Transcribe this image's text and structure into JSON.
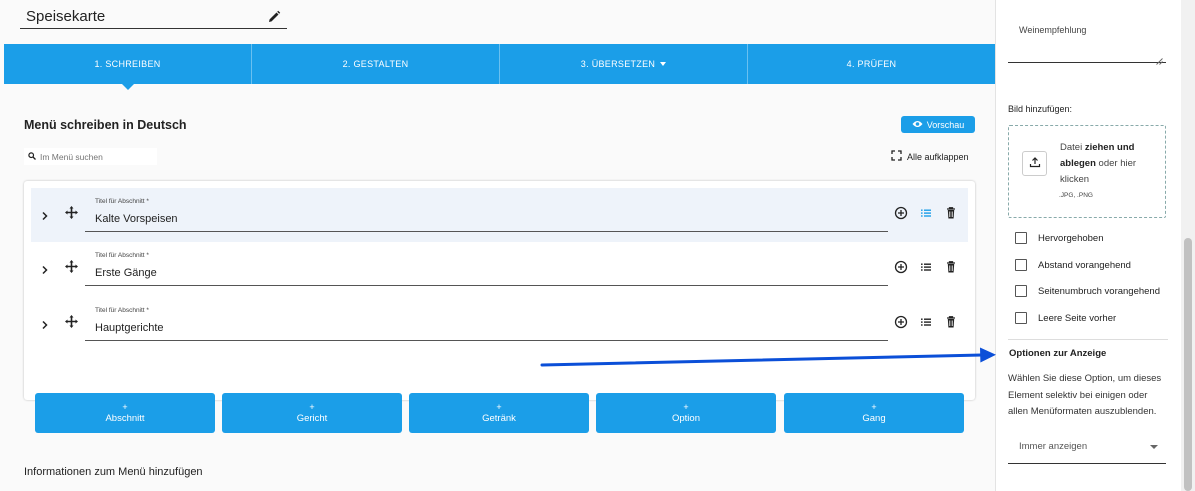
{
  "menu_title": "Speisekarte",
  "steps": [
    {
      "label": "1. SCHREIBEN",
      "active": true
    },
    {
      "label": "2. GESTALTEN",
      "active": false
    },
    {
      "label": "3. ÜBERSETZEN",
      "active": false,
      "dropdown": true
    },
    {
      "label": "4. PRÜFEN",
      "active": false
    }
  ],
  "editor": {
    "heading": "Menü schreiben in Deutsch",
    "preview_label": "Vorschau",
    "search_placeholder": "Im Menü suchen",
    "expand_all_label": "Alle aufklappen"
  },
  "sections": [
    {
      "field_label": "Titel für Abschnitt *",
      "value": "Kalte Vorspeisen",
      "highlighted": true
    },
    {
      "field_label": "Titel für Abschnitt *",
      "value": "Erste Gänge",
      "highlighted": false
    },
    {
      "field_label": "Titel für Abschnitt *",
      "value": "Hauptgerichte",
      "highlighted": false
    }
  ],
  "add_buttons": [
    {
      "plus": "+",
      "label": "Abschnitt"
    },
    {
      "plus": "+",
      "label": "Gericht"
    },
    {
      "plus": "+",
      "label": "Getränk"
    },
    {
      "plus": "+",
      "label": "Option"
    },
    {
      "plus": "+",
      "label": "Gang"
    }
  ],
  "info_heading": "Informationen zum Menü hinzufügen",
  "sidebar": {
    "wine_label": "Weinempfehlung",
    "image_label": "Bild hinzufügen:",
    "dropzone": {
      "text_prefix": "Datei ",
      "text_bold": "ziehen und ablegen",
      "text_suffix": " oder hier klicken",
      "formats": ".JPG, .PNG"
    },
    "checkboxes": [
      {
        "label": "Hervorgehoben",
        "checked": false
      },
      {
        "label": "Abstand vorangehend",
        "checked": false
      },
      {
        "label": "Seitenumbruch vorangehend",
        "checked": false
      },
      {
        "label": "Leere Seite vorher",
        "checked": false
      }
    ],
    "display_options_heading": "Optionen zur Anzeige",
    "display_options_desc": "Wählen Sie diese Option, um dieses Element selektiv bei einigen oder allen Menüformaten auszublenden.",
    "display_select_value": "Immer anzeigen"
  },
  "colors": {
    "accent": "#1b9ee8",
    "annotation_arrow": "#0b4fd8",
    "highlight_row": "#eef3fa"
  },
  "icons": [
    "pencil-icon",
    "eye-icon",
    "search-icon",
    "expand-icon",
    "chevron-right-icon",
    "move-icon",
    "add-circle-icon",
    "list-icon",
    "trash-icon",
    "upload-icon",
    "resize-grip-icon",
    "caret-down-icon"
  ]
}
